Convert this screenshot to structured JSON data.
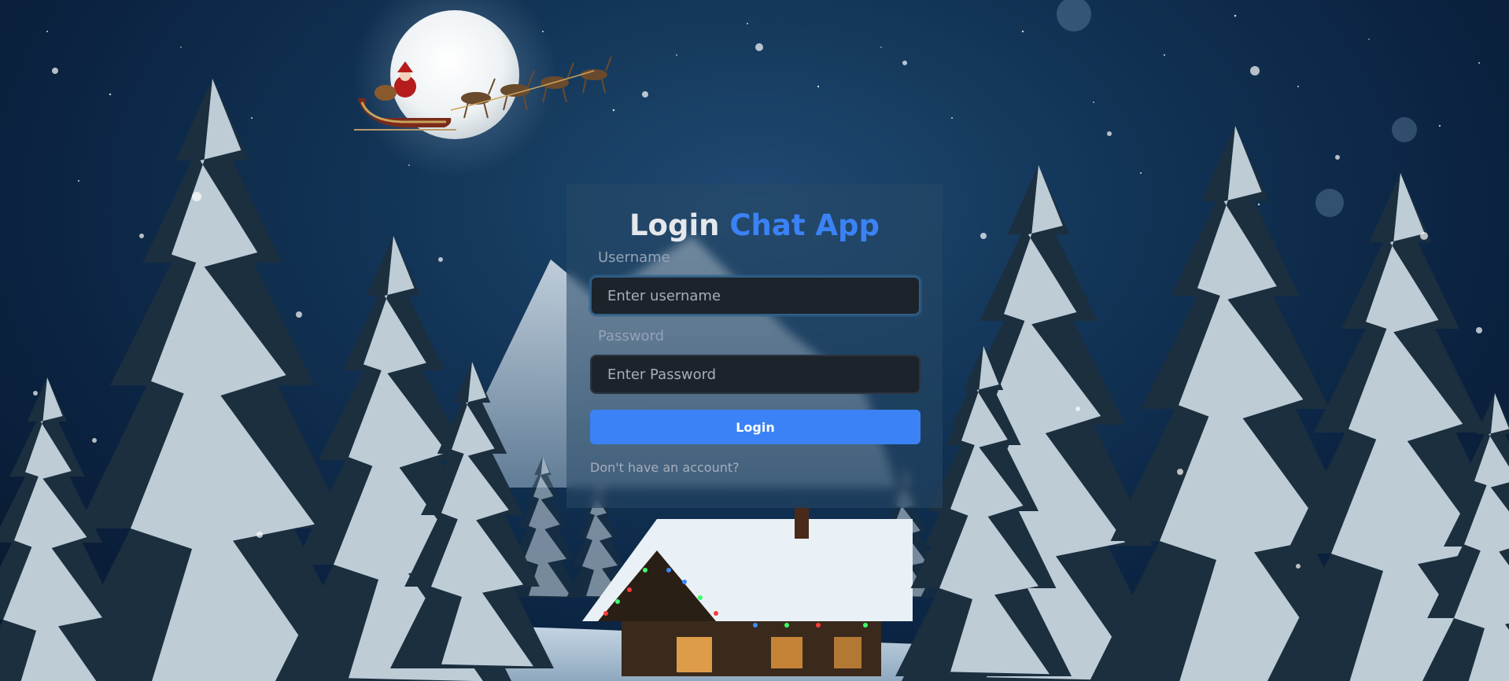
{
  "login_form": {
    "title_prefix": "Login",
    "title_accent": "Chat App",
    "username_label": "Username",
    "username_placeholder": "Enter username",
    "username_value": "",
    "password_label": "Password",
    "password_placeholder": "Enter Password",
    "password_value": "",
    "submit_label": "Login",
    "signup_link": "Don't have an account?"
  },
  "colors": {
    "accent": "#3b82f6",
    "input_bg": "#1d232a",
    "label_text": "#94a3b8"
  },
  "background": {
    "scene": "snowy winter night with moon, santa sleigh, snow-covered pines and lit cabin"
  }
}
